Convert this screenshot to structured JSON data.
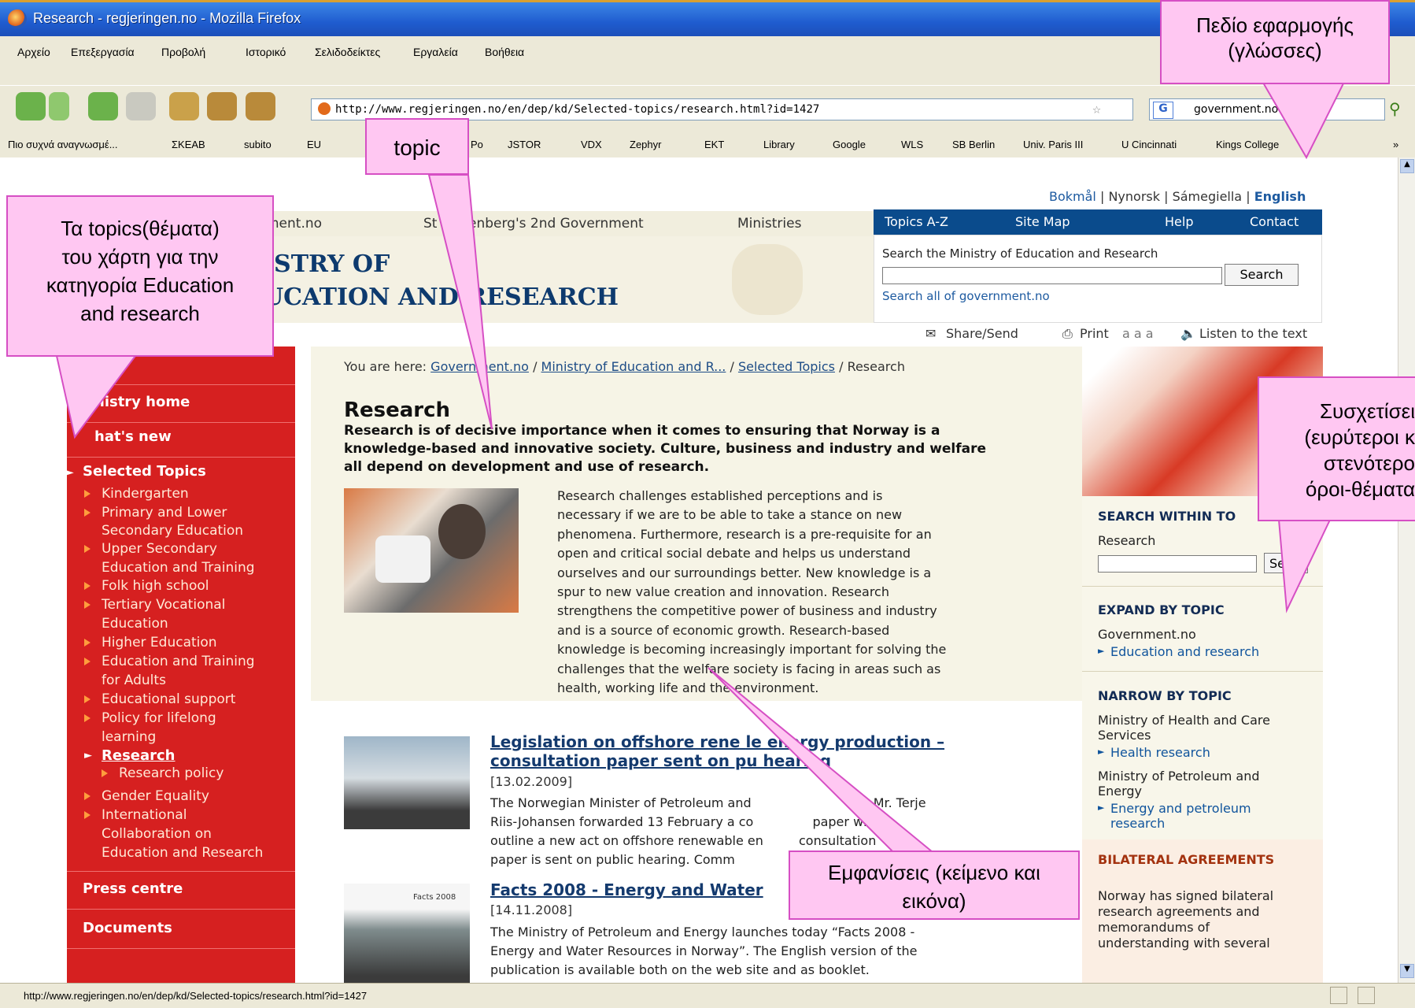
{
  "window": {
    "title": "Research - regjeringen.no - Mozilla Firefox"
  },
  "menu": [
    "Αρχείο",
    "Επεξεργασία",
    "Προβολή",
    "Ιστορικό",
    "Σελιδοδείκτες",
    "Εργαλεία",
    "Βοήθεια"
  ],
  "address": {
    "url": "http://www.regjeringen.no/en/dep/kd/Selected-topics/research.html?id=1427",
    "search_engine_text": "government.no"
  },
  "bookmarks": [
    "Πιο συχνά αναγνωσμέ...",
    "ΣΚΕΑΒ",
    "subito",
    "EU",
    "Po",
    "JSTOR",
    "VDX",
    "Zephyr",
    "EKT",
    "Library",
    "Google",
    "WLS",
    "SB Berlin",
    "Univ. Paris III",
    "U Cincinnati",
    "Kings College"
  ],
  "status": {
    "url": "http://www.regjeringen.no/en/dep/kd/Selected-topics/research.html?id=1427"
  },
  "site": {
    "languages": {
      "bokmal": "Bokmål",
      "nynorsk": "Nynorsk",
      "sami": "Sámegiella",
      "english": "English",
      "sep": "|"
    },
    "topnav": {
      "gov": "vernment.no",
      "stoltenberg": "St",
      "stoltenberg2": "enberg's 2nd Government",
      "ministries": "Ministries"
    },
    "tabs": {
      "topics": "Topics A-Z",
      "sitemap": "Site Map",
      "help": "Help",
      "contact": "Contact"
    },
    "search": {
      "label": "Search the Ministry of Education and Research",
      "button": "Search",
      "all": "Search all of government.no"
    },
    "tools": {
      "share": "Share/Send",
      "print": "Print",
      "sizes": "a a a",
      "listen": "Listen to the text"
    },
    "logo": {
      "line1": "ISTRY OF",
      "line2": "UCATION AND RESEARCH"
    },
    "breadcrumb": {
      "prefix": "You are here:",
      "b1": "Gove",
      "b1b": "rnment.no",
      "sep": "/",
      "b2": "Ministry of Education and R...",
      "b3": "Selected Topics",
      "b4": "Research"
    },
    "leftnav": {
      "home": "nistry home",
      "whatsnew": "hat's new",
      "selected": "Selected Topics",
      "items": [
        "Kindergarten",
        "Primary and Lower",
        "Secondary Education",
        "Upper Secondary",
        "Education and Training",
        "Folk high school",
        "Tertiary Vocational",
        "Education",
        "Higher Education",
        "Education and Training",
        "for Adults",
        "Educational support",
        "Policy for lifelong",
        "learning"
      ],
      "research": "Research",
      "research_policy": "Research policy",
      "items2": [
        "Gender Equality",
        "International",
        "Collaboration on",
        "Education and Research"
      ],
      "press": "Press centre",
      "documents": "Documents"
    },
    "article": {
      "title": "Research",
      "lead": [
        "Research is of decisive importance when it comes to ensuring that Norway is a",
        "knowledge-based and innovative society. Culture, business and industry and welfare",
        "all depend on development and use of research."
      ],
      "body": [
        "Research challenges established perceptions and is",
        "necessary if we are to be able to take a stance on new",
        "phenomena. Furthermore, research is a pre-requisite for an",
        "open and critical social debate and helps us understand",
        "ourselves and our surroundings better. New knowledge is a",
        "spur to new value creation and innovation. Research",
        "strengthens the competitive power of business and industry",
        "and is a source of economic growth. Research-based",
        "knowledge is becoming increasingly important for solving the",
        "challenges that the welfare society is facing in areas such as",
        "health, working life and the environment."
      ]
    },
    "news": [
      {
        "title1": "Legislation on offshore rene",
        "title1b": "le energy production –",
        "title2": "consultation paper sent on pu",
        "title2b": "hearing",
        "date": "[13.02.2009]",
        "text": [
          "The Norwegian Minister of Petroleum and",
          "Mr. Terje",
          "Riis-Johansen forwarded 13 February a co",
          "paper which",
          "outline a new act on offshore renewable en",
          "consultation",
          "paper is sent on public hearing. Comm"
        ]
      },
      {
        "title1": "Facts 2008 - Energy and Water",
        "date": "[14.11.2008]",
        "thumb": "Facts 2008",
        "text": [
          "The Ministry of Petroleum and Energy launches today “Facts 2008 -",
          "Energy and Water Resources in Norway”. The English version of the",
          "publication is available both on the web site and as booklet."
        ]
      }
    ],
    "right": {
      "search_head": "SEARCH WITHIN TO",
      "search_label": "Research",
      "search_btn": "Se",
      "expand_head": "EXPAND BY TOPIC",
      "expand_gov": "Government.no",
      "expand_link": "Education and research",
      "narrow_head": "NARROW BY TOPIC",
      "narrow1": [
        "Ministry of Health and Care",
        "Services"
      ],
      "narrow1_link": "Health research",
      "narrow2": [
        "Ministry of Petroleum and",
        "Energy"
      ],
      "narrow2_link": [
        "Energy and petroleum",
        "research"
      ],
      "bilateral_head": "BILATERAL AGREEMENTS",
      "bilateral_text": [
        "Norway has signed bilateral",
        "research agreements and",
        "memorandums of",
        "understanding with several"
      ]
    }
  },
  "callouts": {
    "apps": [
      "Πεδίο εφαρμογής",
      "(γλώσσες)"
    ],
    "topic": "topic",
    "topics": [
      "Τα topics(θέματα)",
      "του χάρτη για την",
      "κατηγορία Education",
      "and research"
    ],
    "relations": [
      "Συσχετίσει",
      "(ευρύτεροι κ",
      "στενότερο",
      "όροι-θέματα"
    ],
    "occurrences": [
      "Εμφανίσεις (κείμενο και",
      "εικόνα)"
    ]
  }
}
